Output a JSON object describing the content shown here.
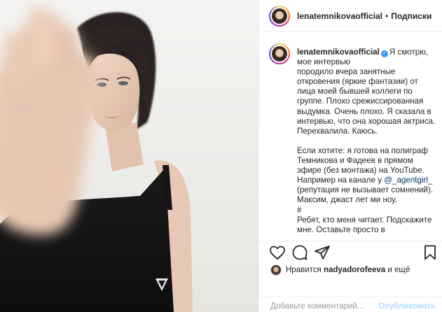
{
  "post": {
    "username": "lenatemnikovaofficial",
    "header_separator": "•",
    "follow_label": "Подписки",
    "verified_glyph": "✓",
    "caption_paragraphs": [
      "Я смотрю,\nмое интервью\nпородило вчера занятные\nоткровения (яркие фантазии) от\nлица моей бывшей коллеги по\nгруппе. Плохо срежиссированная\nвыдумка. Очень плохо. Я сказала в\nинтервью, что она хорошая актриса.\nПерехвалила. Каюсь."
    ],
    "caption_second_before": "Если хотите: я готова на полиграф\nТемникова и Фадеев в прямом\nэфире (без монтажа) на YouTube.\nНапример на канале у ",
    "caption_mention": "@_agentgirl_",
    "caption_second_after": "\n(репутация не вызывает сомнений).\nМаксим, джаст лет ми ноу.\n#\nРебят, кто меня читает. Подскажите\nмне. Оставьте просто в",
    "likes_prefix": "Нравится",
    "likes_user": "nadyadorofeeva",
    "likes_suffix": "и ещё",
    "comment_placeholder": "Добавьте комментарий...",
    "post_label": "Опубликовать"
  },
  "icons": {
    "like": "heart-icon",
    "comment": "comment-icon",
    "share": "share-icon",
    "save": "bookmark-icon"
  },
  "colors": {
    "verified": "#3897f0",
    "mention": "#003569",
    "post_disabled": "#b3dbff"
  }
}
